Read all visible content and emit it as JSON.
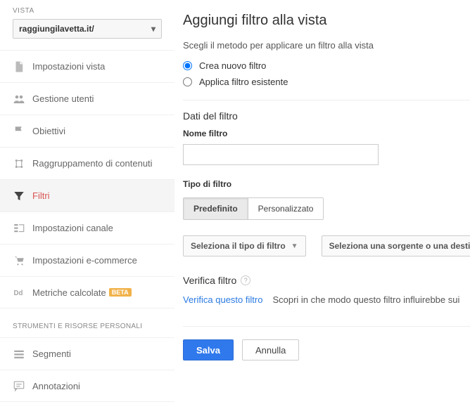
{
  "sidebar": {
    "vista_label": "VISTA",
    "property": "raggiungilavetta.it/",
    "menu": [
      {
        "label": "Impostazioni vista",
        "icon": "document"
      },
      {
        "label": "Gestione utenti",
        "icon": "users"
      },
      {
        "label": "Obiettivi",
        "icon": "flag"
      },
      {
        "label": "Raggruppamento di contenuti",
        "icon": "group"
      },
      {
        "label": "Filtri",
        "icon": "filter",
        "active": true
      },
      {
        "label": "Impostazioni canale",
        "icon": "channel"
      },
      {
        "label": "Impostazioni e-commerce",
        "icon": "cart"
      },
      {
        "label": "Metriche calcolate",
        "icon": "dd",
        "beta": "BETA"
      }
    ],
    "tools_heading": "STRUMENTI E RISORSE PERSONALI",
    "tools": [
      {
        "label": "Segmenti",
        "icon": "segments"
      },
      {
        "label": "Annotazioni",
        "icon": "annotations"
      }
    ]
  },
  "main": {
    "title": "Aggiungi filtro alla vista",
    "choose_method": "Scegli il metodo per applicare un filtro alla vista",
    "radio_new": "Crea nuovo filtro",
    "radio_existing": "Applica filtro esistente",
    "data_section": "Dati del filtro",
    "name_label": "Nome filtro",
    "type_label": "Tipo di filtro",
    "toggle_predefined": "Predefinito",
    "toggle_custom": "Personalizzato",
    "select_type": "Seleziona il tipo di filtro",
    "select_source": "Seleziona una sorgente o una destinazione",
    "verify_title": "Verifica filtro",
    "verify_link": "Verifica questo filtro",
    "verify_text": "Scopri in che modo questo filtro influirebbe sui",
    "save": "Salva",
    "cancel": "Annulla"
  }
}
